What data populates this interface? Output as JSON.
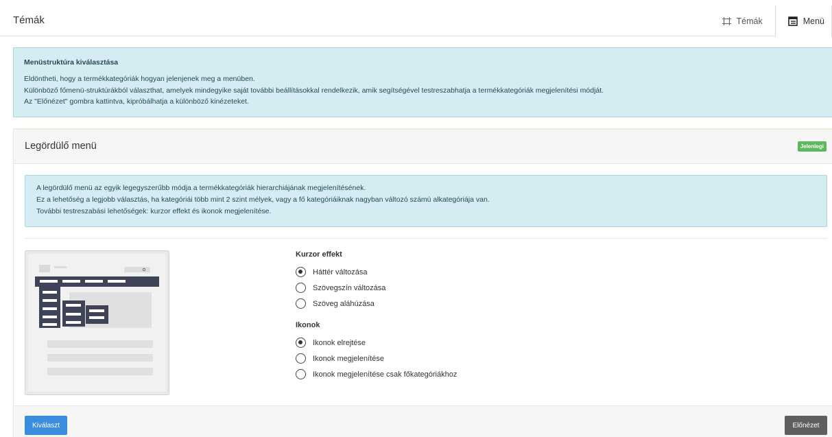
{
  "header": {
    "title": "Témák",
    "tabs": [
      {
        "label": "Témák",
        "icon": "frame-icon",
        "active": false
      },
      {
        "label": "Menü",
        "icon": "menu-list-icon",
        "active": true
      }
    ]
  },
  "info": {
    "title": "Menüstruktúra kiválasztása",
    "lines": [
      "Eldöntheti, hogy a termékkategóriák hogyan jelenjenek meg a menüben.",
      "Különböző főmenü-struktúrákból választhat, amelyek mindegyike saját további beállításokkal rendelkezik, amik segítségével testreszabhatja a termékkategóriák megjelenítési módját.",
      "Az \"Előnézet\" gombra kattintva, kipróbálhatja a különböző kinézeteket."
    ]
  },
  "card": {
    "title": "Legördülő menü",
    "badge": "Jelenlegi",
    "badge_color": "#5cb85c",
    "info_lines": [
      "A legördülő menü az egyik legegyszerűbb módja a termékkategóriák hierarchiájának megjelenítésének.",
      "Ez a lehetőség a legjobb választás, ha kategóriái több mint 2 szint mélyek, vagy a fő kategóriáiknak nagyban változó számú alkategóriája van.",
      "További testreszabási lehetőségek: kurzor effekt és ikonok megjelenítése."
    ],
    "groups": [
      {
        "title": "Kurzor effekt",
        "options": [
          {
            "label": "Háttér változása",
            "checked": true
          },
          {
            "label": "Szövegszín változása",
            "checked": false
          },
          {
            "label": "Szöveg aláhúzása",
            "checked": false
          }
        ]
      },
      {
        "title": "Ikonok",
        "options": [
          {
            "label": "Ikonok elrejtése",
            "checked": true
          },
          {
            "label": "Ikonok megjelenítése",
            "checked": false
          },
          {
            "label": "Ikonok megjelenítése csak főkategóriákhoz",
            "checked": false
          }
        ]
      }
    ],
    "buttons": {
      "select": "Kiválaszt",
      "preview": "Előnézet"
    }
  },
  "colors": {
    "info_bg": "#d6ecf3",
    "primary": "#3b8de0",
    "secondary": "#5f5f5f",
    "menu_dark": "#3f4357"
  }
}
